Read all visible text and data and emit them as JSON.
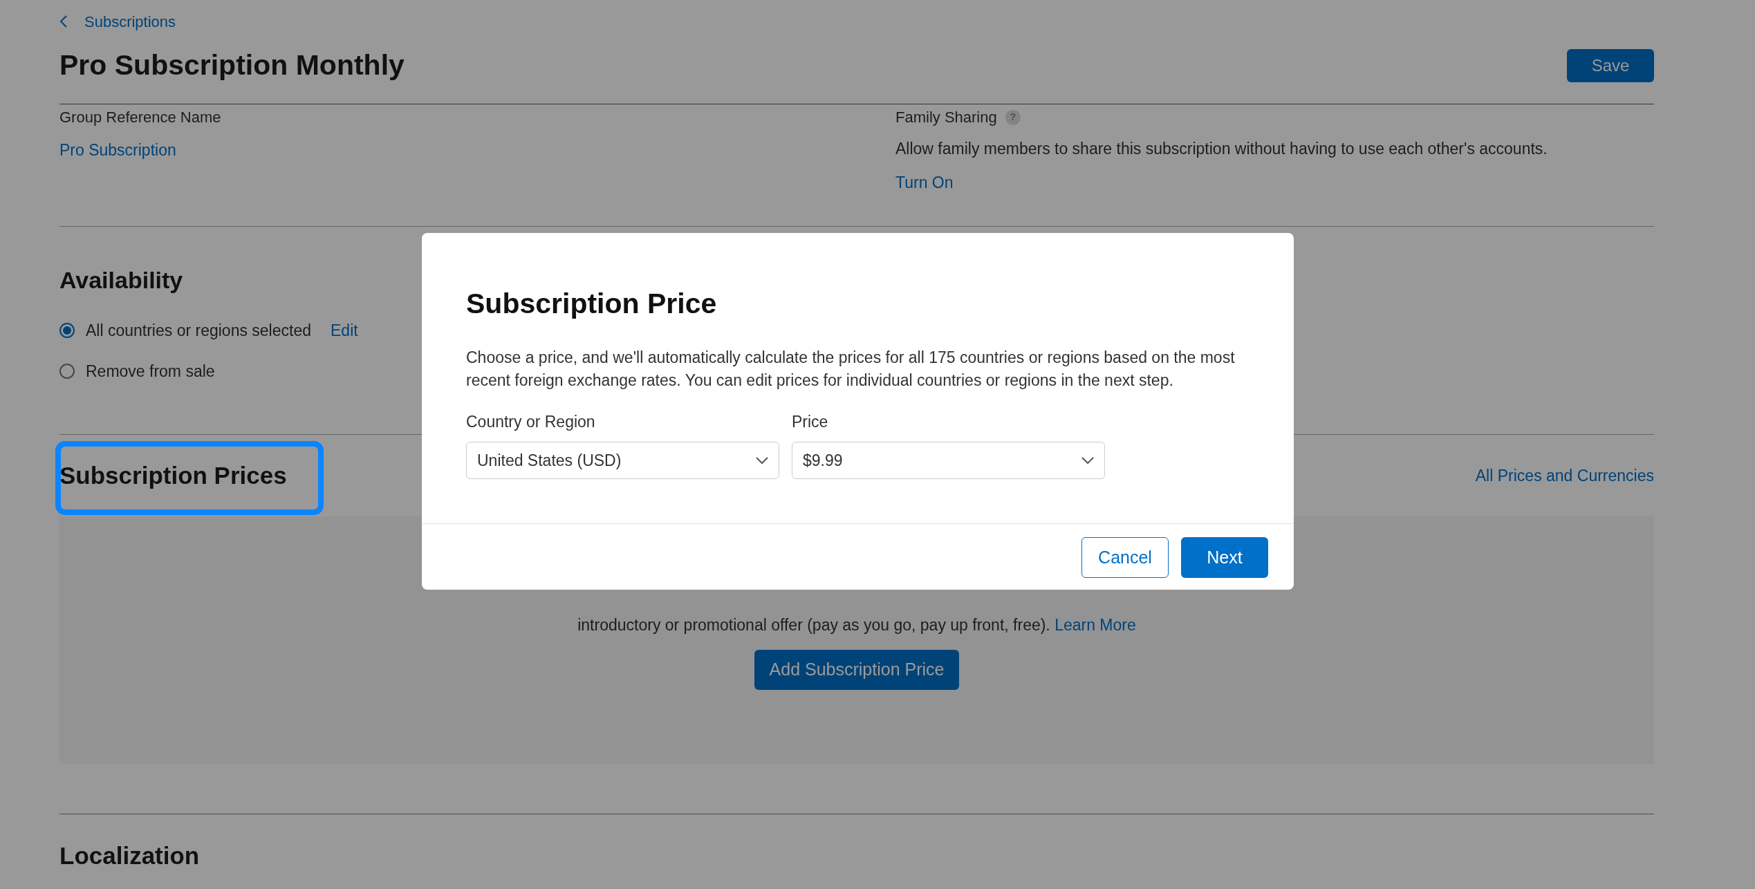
{
  "breadcrumb": {
    "label": "Subscriptions"
  },
  "page_title": "Pro Subscription Monthly",
  "save_button": "Save",
  "group_reference": {
    "label": "Group Reference Name",
    "value": "Pro Subscription"
  },
  "family_sharing": {
    "label": "Family Sharing",
    "help": "?",
    "description": "Allow family members to share this subscription without having to use each other's accounts.",
    "action": "Turn On"
  },
  "availability": {
    "title": "Availability",
    "options": [
      {
        "label": "All countries or regions selected",
        "selected": true,
        "action": "Edit"
      },
      {
        "label": "Remove from sale",
        "selected": false
      }
    ]
  },
  "subscription_prices": {
    "title": "Subscription Prices",
    "focused": true,
    "link": "All Prices and Currencies",
    "empty_state": {
      "text": "introductory or promotional offer (pay as you go, pay up front, free).",
      "link": "Learn More",
      "button": "Add Subscription Price"
    }
  },
  "localization": {
    "title": "Localization"
  },
  "modal": {
    "title": "Subscription Price",
    "description": "Choose a price, and we'll automatically calculate the prices for all 175 countries or regions based on the most recent foreign exchange rates. You can edit prices for individual countries or regions in the next step.",
    "fields": [
      {
        "label": "Country or Region",
        "value": "United States (USD)"
      },
      {
        "label": "Price",
        "value": "$9.99"
      }
    ],
    "buttons": [
      {
        "label": "Cancel",
        "kind": "secondary"
      },
      {
        "label": "Next",
        "kind": "primary"
      }
    ]
  }
}
